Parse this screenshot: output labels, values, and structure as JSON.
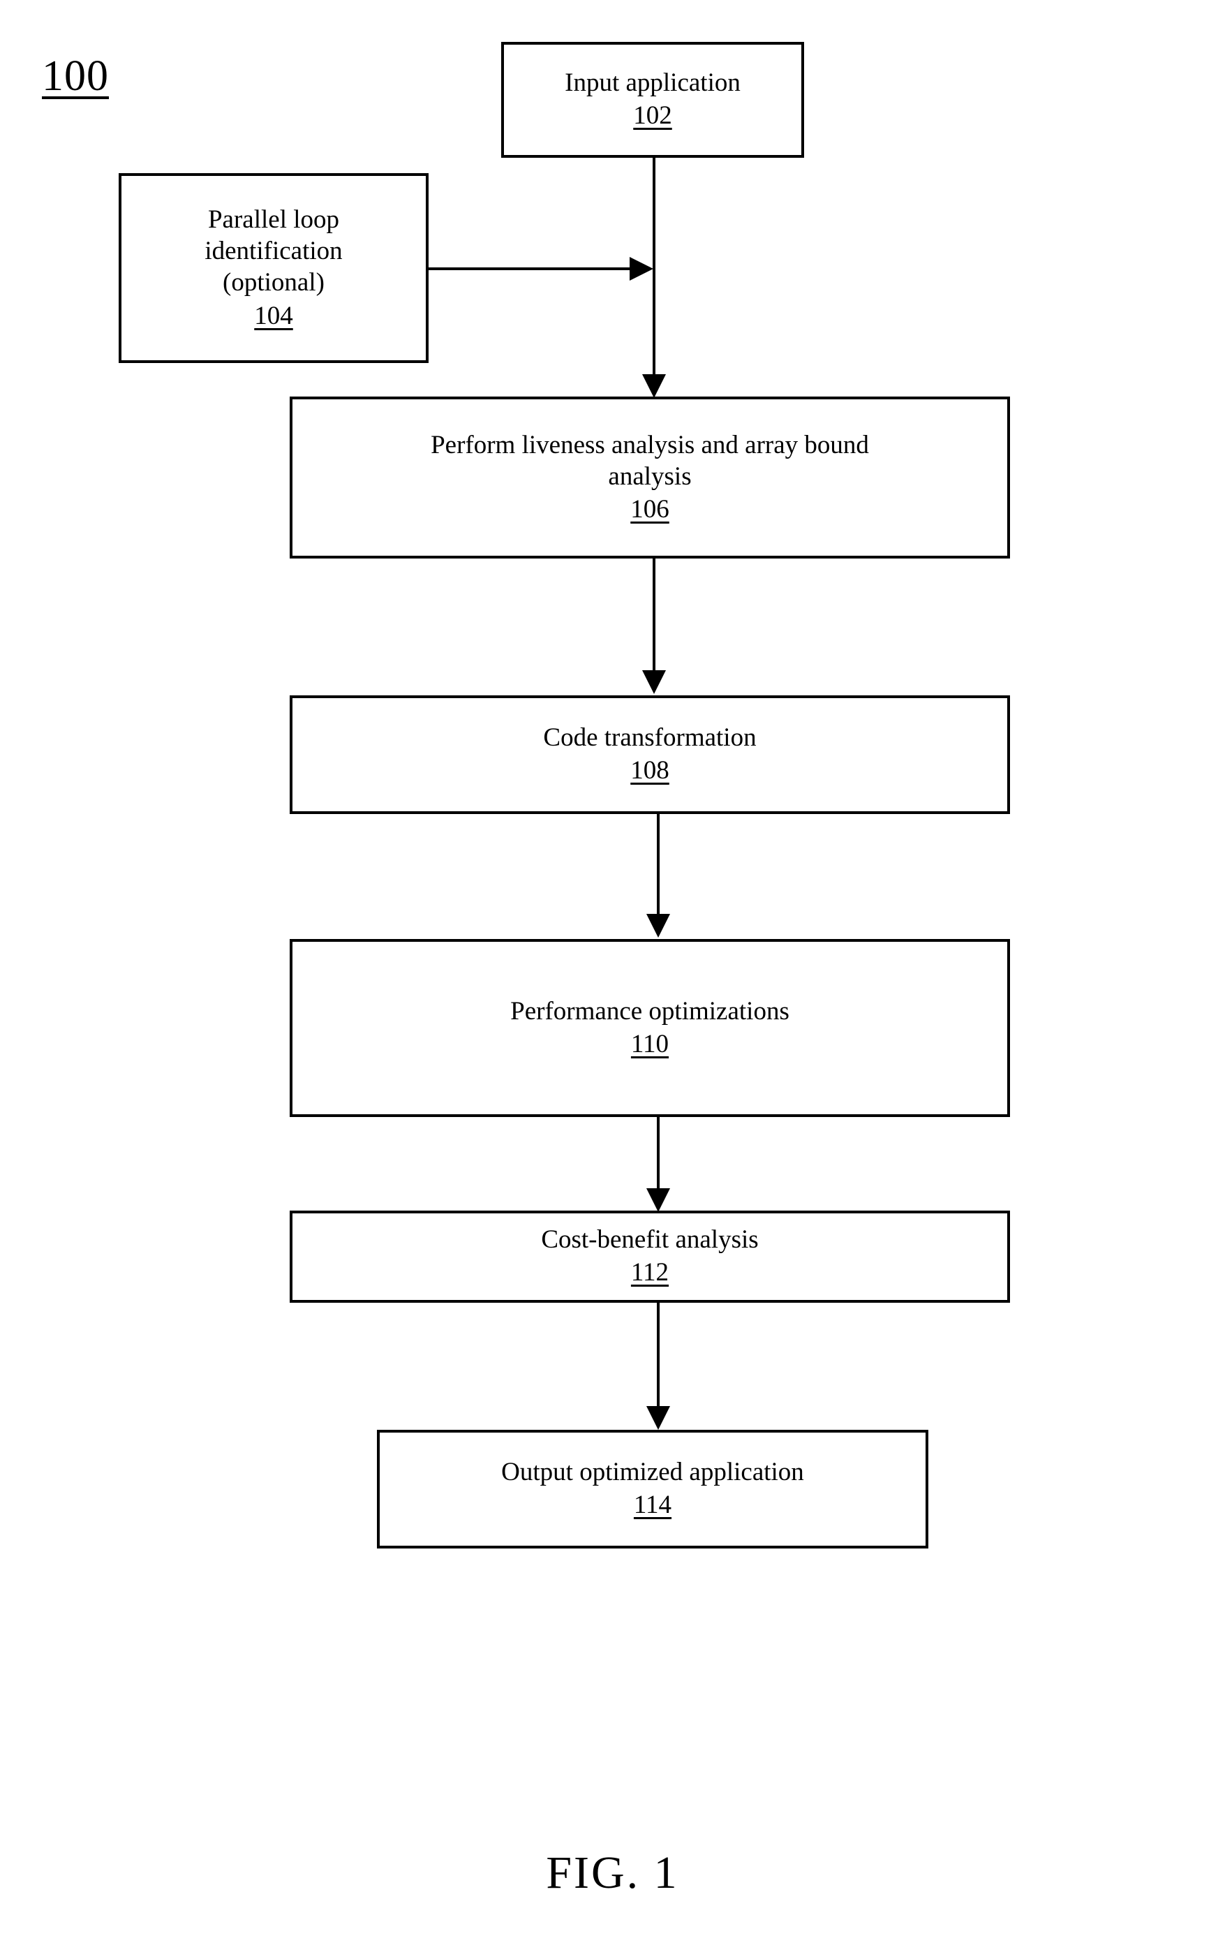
{
  "figure": {
    "reference_numeral": "100",
    "caption": "FIG. 1"
  },
  "nodes": [
    {
      "id": "102",
      "label": "Input application",
      "number": "102",
      "name": "node-input-application"
    },
    {
      "id": "104",
      "label": "Parallel loop\nidentification\n(optional)",
      "number": "104",
      "name": "node-parallel-loop-identification"
    },
    {
      "id": "106",
      "label": "Perform liveness analysis and array bound\nanalysis",
      "number": "106",
      "name": "node-liveness-array-bound-analysis"
    },
    {
      "id": "108",
      "label": "Code transformation",
      "number": "108",
      "name": "node-code-transformation"
    },
    {
      "id": "110",
      "label": "Performance optimizations",
      "number": "110",
      "name": "node-performance-optimizations"
    },
    {
      "id": "112",
      "label": "Cost-benefit analysis",
      "number": "112",
      "name": "node-cost-benefit-analysis"
    },
    {
      "id": "114",
      "label": "Output optimized application",
      "number": "114",
      "name": "node-output-optimized-application"
    }
  ],
  "connectors": [
    {
      "from": "102",
      "to": "106",
      "direction": "down"
    },
    {
      "from": "104",
      "to": "102-106-link",
      "direction": "right"
    },
    {
      "from": "106",
      "to": "108",
      "direction": "down"
    },
    {
      "from": "108",
      "to": "110",
      "direction": "down"
    },
    {
      "from": "110",
      "to": "112",
      "direction": "down"
    },
    {
      "from": "112",
      "to": "114",
      "direction": "down"
    }
  ],
  "colors": {
    "stroke": "#000000",
    "background": "#ffffff"
  }
}
